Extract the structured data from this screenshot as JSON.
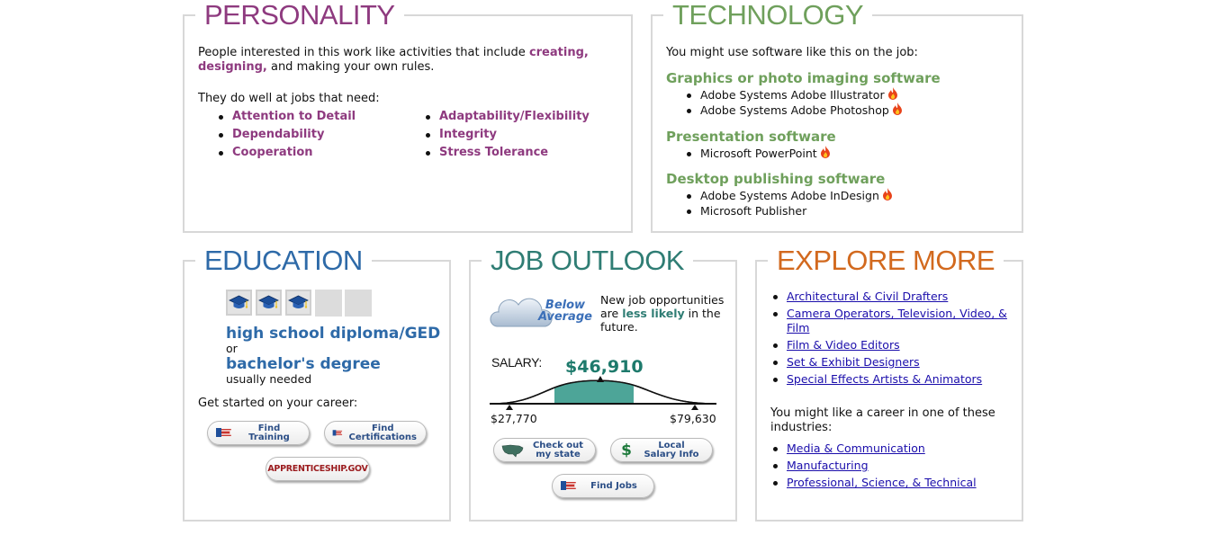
{
  "personality": {
    "title": "PERSONALITY",
    "intro_before": "People interested in this work like activities that include ",
    "intro_highlight": "creating, designing,",
    "intro_after": " and making your own rules.",
    "needs_label": "They do well at jobs that need:",
    "traits_left": [
      "Attention to Detail",
      "Dependability",
      "Cooperation"
    ],
    "traits_right": [
      "Adaptability/Flexibility",
      "Integrity",
      "Stress Tolerance"
    ]
  },
  "technology": {
    "title": "TECHNOLOGY",
    "intro": "You might use software like this on the job:",
    "groups": [
      {
        "name": "Graphics or photo imaging software",
        "items": [
          {
            "label": "Adobe Systems Adobe Illustrator",
            "hot": true
          },
          {
            "label": "Adobe Systems Adobe Photoshop",
            "hot": true
          }
        ]
      },
      {
        "name": "Presentation software",
        "items": [
          {
            "label": "Microsoft PowerPoint",
            "hot": true
          }
        ]
      },
      {
        "name": "Desktop publishing software",
        "items": [
          {
            "label": "Adobe Systems Adobe InDesign",
            "hot": true
          },
          {
            "label": "Microsoft Publisher",
            "hot": false
          }
        ]
      }
    ]
  },
  "education": {
    "title": "EDUCATION",
    "level_count": 3,
    "level_max": 5,
    "level_primary": "high school diploma/GED",
    "or_text": "or",
    "level_secondary": "bachelor's degree",
    "usually": "usually needed",
    "get_started": "Get started on your career:",
    "btn_training": "Find Training",
    "btn_cert_1": "Find",
    "btn_cert_2": "Certifications",
    "btn_apprentice": "APPRENTICESHIP.GOV"
  },
  "outlook": {
    "title": "JOB OUTLOOK",
    "badge_1": "Below",
    "badge_2": "Average",
    "text_before": "New job opportunities are ",
    "text_highlight": "less likely",
    "text_after": " in the future.",
    "salary_label": "SALARY:",
    "salary_median": "$46,910",
    "salary_low": "$27,770",
    "salary_high": "$79,630",
    "btn_state_1": "Check out",
    "btn_state_2": "my state",
    "btn_local_1": "Local",
    "btn_local_2": "Salary Info",
    "btn_jobs": "Find Jobs"
  },
  "explore": {
    "title": "EXPLORE MORE",
    "careers": [
      "Architectural & Civil Drafters",
      "Camera Operators, Television, Video, & Film",
      "Film & Video Editors",
      "Set & Exhibit Designers",
      "Special Effects Artists & Animators"
    ],
    "industries_intro": "You might like a career in one of these industries:",
    "industries": [
      "Media & Communication",
      "Manufacturing",
      "Professional, Science, & Technical"
    ]
  },
  "colors": {
    "personality": "#8e3a7f",
    "technology": "#6fa05c",
    "education": "#2e6aa8",
    "outlook": "#2f7d74",
    "explore": "#d2691e",
    "salary_fill": "#4da598"
  },
  "icons": {
    "hot_technology": "flame-icon",
    "education_level": "graduation-cap-icon",
    "training": "flag-icon",
    "state": "us-map-icon",
    "local_salary": "dollar-icon",
    "outlook_badge": "cloud-icon"
  }
}
